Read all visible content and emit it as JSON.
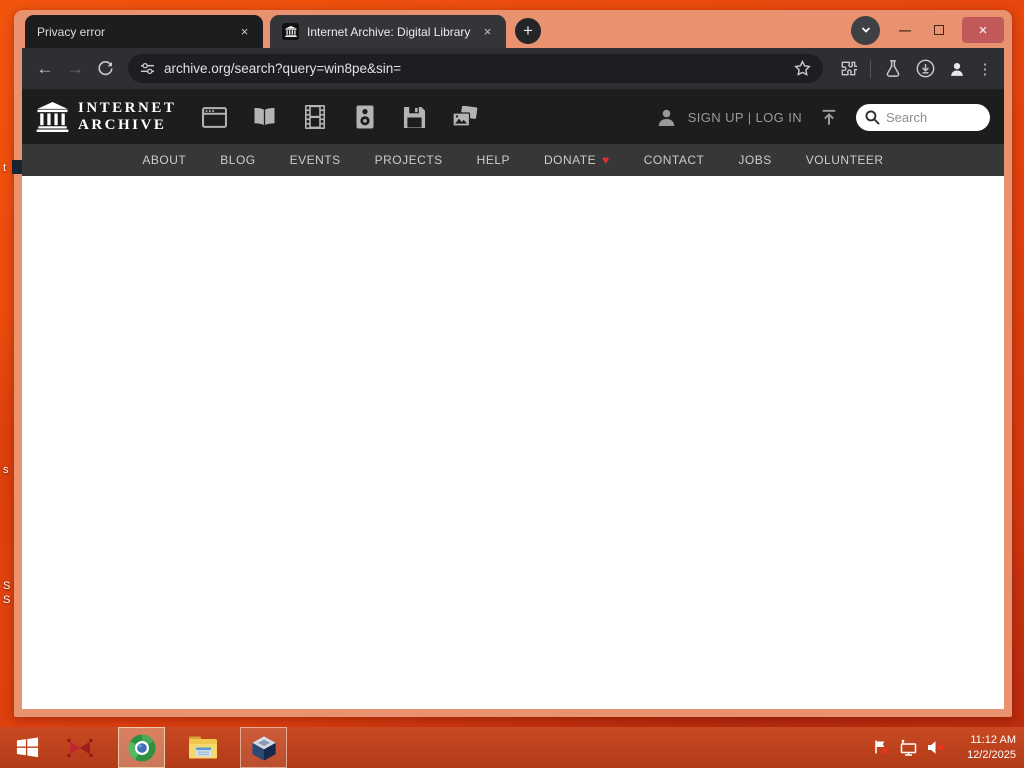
{
  "desktop": {
    "fragments": [
      "t",
      "s",
      "S",
      "S"
    ]
  },
  "browser": {
    "tabs": [
      {
        "title": "Privacy error"
      },
      {
        "title": "Internet Archive: Digital Library"
      }
    ],
    "url": "archive.org/search?query=win8pe&sin="
  },
  "ia": {
    "logo_line1": "INTERNET",
    "logo_line2": "ARCHIVE",
    "auth_text": "SIGN UP | LOG IN",
    "search_placeholder": "Search",
    "nav": [
      "ABOUT",
      "BLOG",
      "EVENTS",
      "PROJECTS",
      "HELP",
      "DONATE",
      "CONTACT",
      "JOBS",
      "VOLUNTEER"
    ],
    "media_types": [
      "web",
      "texts",
      "video",
      "audio",
      "software",
      "images"
    ]
  },
  "taskbar": {
    "time": "11:12 AM",
    "date": "12/2/2025"
  },
  "icons": {
    "back": "←",
    "forward": "→",
    "plus": "+",
    "close": "×",
    "minimize": "—",
    "kebab": "⋮",
    "heart": "♥"
  },
  "colors": {
    "desktop_orange": "#e8470d",
    "window_frame": "#e9926f",
    "taskbar_red": "#c6421a",
    "toolbar_dark": "#2e2f32",
    "ia_header": "#1d1d1d",
    "ia_nav": "#373737",
    "heart_red": "#e03131",
    "close_button": "#c25a5b"
  }
}
